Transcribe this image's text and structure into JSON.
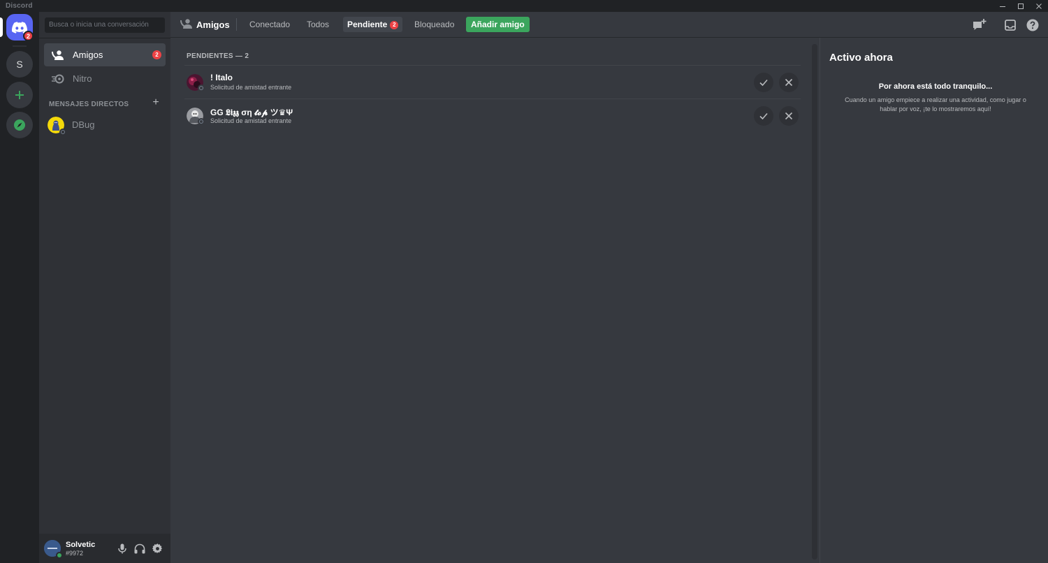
{
  "window": {
    "title": "Discord"
  },
  "servers": {
    "home_badge": "2",
    "server_s_label": "S"
  },
  "sidebar": {
    "search_placeholder": "Busca o inicia una conversación",
    "nav": [
      {
        "label": "Amigos",
        "badge": "2"
      },
      {
        "label": "Nitro"
      }
    ],
    "dm_header": "MENSAJES DIRECTOS",
    "dm_add": "+",
    "dms": [
      {
        "name": "DBug"
      }
    ]
  },
  "user": {
    "name": "Solvetic",
    "tag": "#9972"
  },
  "topbar": {
    "title": "Amigos",
    "tabs": [
      {
        "label": "Conectado"
      },
      {
        "label": "Todos"
      },
      {
        "label": "Pendiente",
        "badge": "2"
      },
      {
        "label": "Bloqueado"
      }
    ],
    "add_friend": "Añadir amigo"
  },
  "pending": {
    "header": "PENDIENTES — 2",
    "requests": [
      {
        "name": "! Italo",
        "subtitle": "Solicitud de amistad entrante"
      },
      {
        "name": "GG 𝕷𝖎𝖟𝖟 ση 𝓽𝓸𝓹 ツ♛Ψ",
        "subtitle": "Solicitud de amistad entrante"
      }
    ]
  },
  "active_now": {
    "title": "Activo ahora",
    "empty_title": "Por ahora está todo tranquilo...",
    "empty_desc": "Cuando un amigo empiece a realizar una actividad, como jugar o hablar por voz, ¡te lo mostraremos aquí!"
  },
  "colors": {
    "blurple": "#5865f2",
    "green": "#3ba55d",
    "red": "#ed4245",
    "background": "#36393f"
  }
}
